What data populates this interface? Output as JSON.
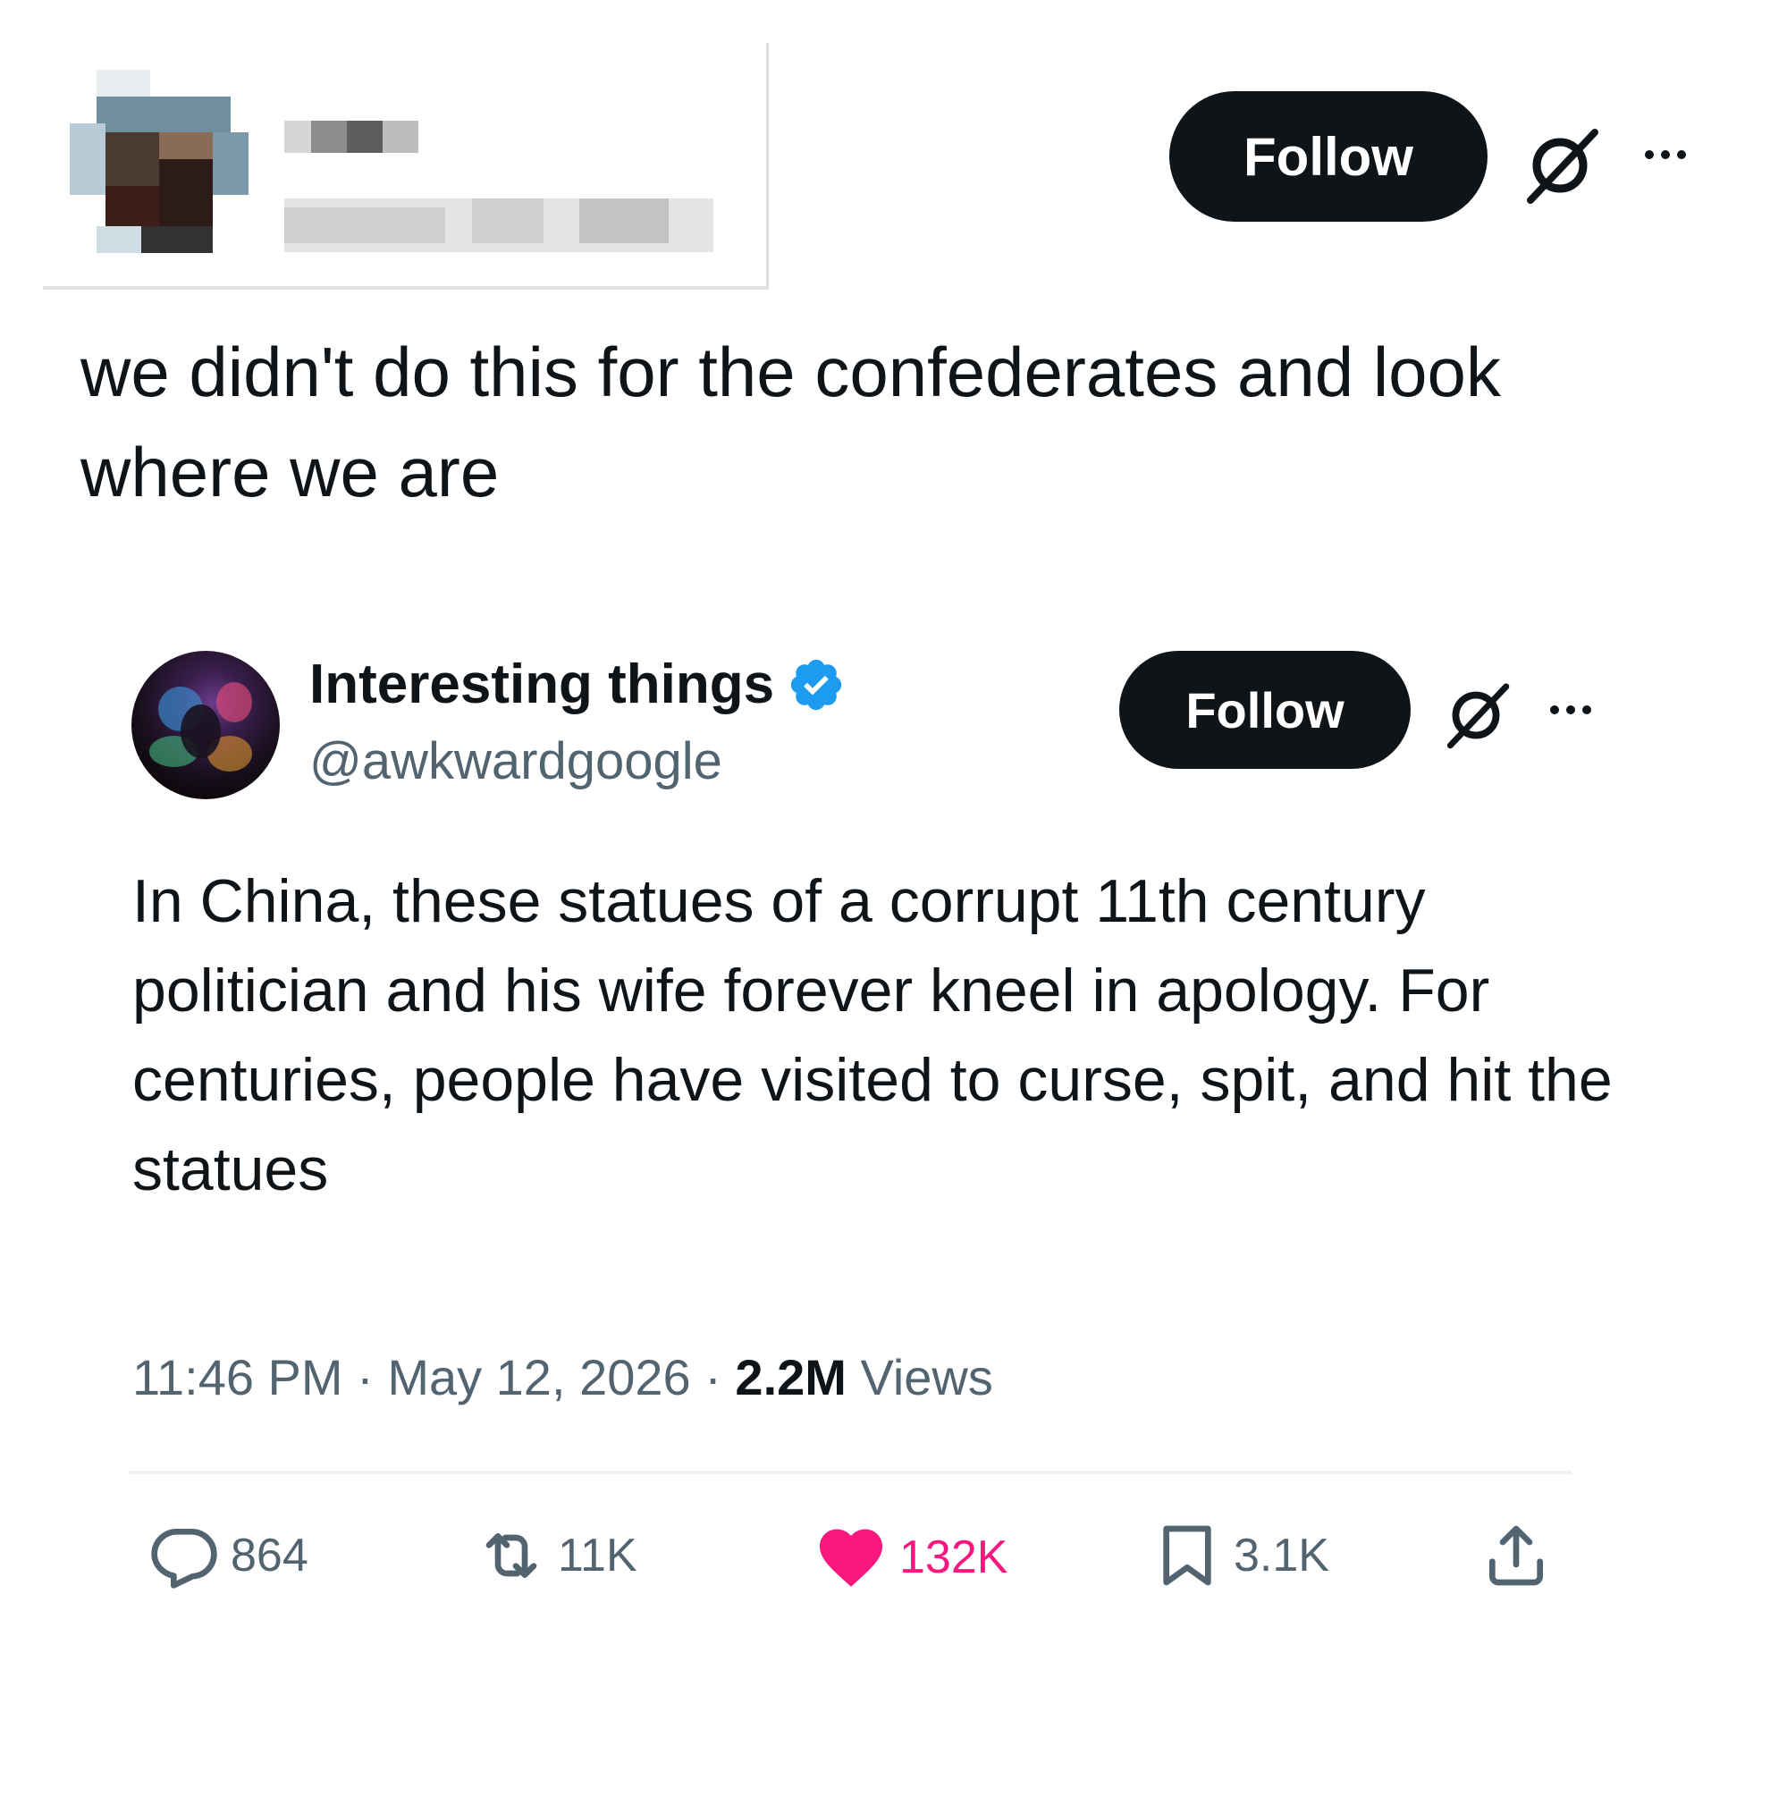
{
  "top_tweet": {
    "follow_label": "Follow",
    "text": "we didn't do this for the confederates and look where we are"
  },
  "quoted_tweet": {
    "display_name": "Interesting things",
    "handle": "@awkwardgoogle",
    "follow_label": "Follow",
    "text": "In China, these statues of a corrupt 11th century politician and his wife forever kneel in apology. For centuries, people have visited to curse, spit, and hit the statues",
    "time": "11:46 PM",
    "date": "May 12, 2026",
    "separator": " · ",
    "views_count": "2.2M",
    "views_label": " Views",
    "actions": {
      "replies": "864",
      "reposts": "11K",
      "likes": "132K",
      "bookmarks": "3.1K"
    }
  },
  "colors": {
    "text": "#0f1419",
    "muted": "#536471",
    "like": "#f91880",
    "verified": "#1d9bf0",
    "button": "#0f1419"
  }
}
